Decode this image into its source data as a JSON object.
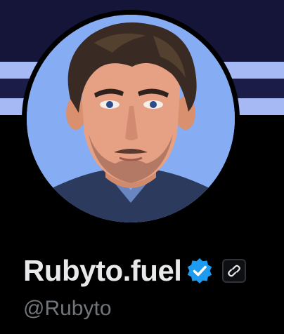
{
  "profile": {
    "display_name": "Rubyto.fuel",
    "handle": "@Rubyto",
    "verified": true
  },
  "icons": {
    "verified": "verified-badge-icon",
    "affiliate_link": "link-chain-icon"
  },
  "colors": {
    "background": "#000000",
    "banner_dark": "#15153a",
    "banner_stripe": "#a6b9f4",
    "name_text": "#e7e9ea",
    "handle_text": "#71767b",
    "verified_blue": "#1d9bf0",
    "avatar_background": "#7fa8f2"
  }
}
